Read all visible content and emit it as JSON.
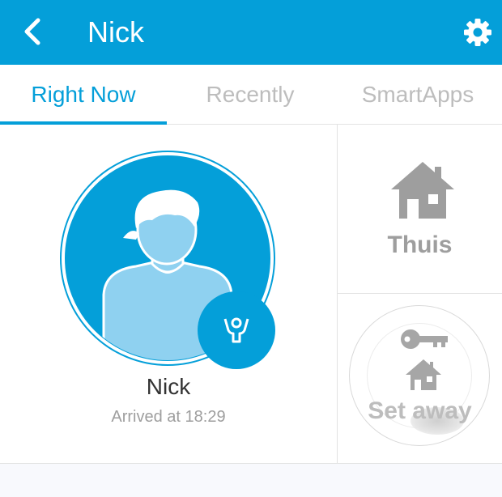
{
  "header": {
    "title": "Nick",
    "back_icon": "chevron-left-icon",
    "settings_icon": "gear-icon",
    "background_color": "#049fd9"
  },
  "tabs": [
    {
      "label": "Right Now",
      "active": true
    },
    {
      "label": "Recently",
      "active": false
    },
    {
      "label": "SmartApps",
      "active": false
    }
  ],
  "person": {
    "name": "Nick",
    "status": "Arrived at 18:29",
    "badge_icon": "present-person-icon"
  },
  "mode": {
    "label": "Thuis",
    "icon": "house-icon"
  },
  "routine": {
    "label": "Set away",
    "icons": [
      "key-icon",
      "house-icon"
    ]
  },
  "colors": {
    "accent": "#049fd9",
    "avatar_light": "#8fd1f0",
    "muted_text": "#9e9e9e"
  }
}
